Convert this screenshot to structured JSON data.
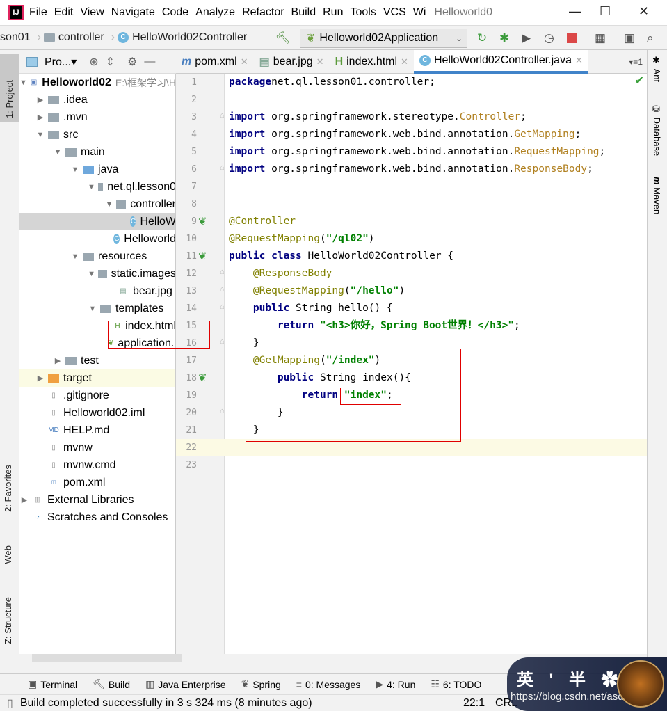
{
  "menubar": {
    "items": [
      "File",
      "Edit",
      "View",
      "Navigate",
      "Code",
      "Analyze",
      "Refactor",
      "Build",
      "Run",
      "Tools",
      "VCS",
      "Wi"
    ],
    "title": "Helloworld0"
  },
  "navbar": {
    "crumbs": [
      "son01",
      "controller",
      "HelloWorld02Controller"
    ],
    "run_config": "Helloworld02Application"
  },
  "project_panel": {
    "title": "Pro..."
  },
  "left_stripe": {
    "tabs": [
      "1: Project",
      "2: Favorites",
      "Web",
      "Z: Structure"
    ]
  },
  "right_stripe": {
    "tabs": [
      "Ant",
      "Database",
      "Maven"
    ]
  },
  "tree": [
    {
      "label": "Helloworld02",
      "sub": "E:\\框架学习\\H",
      "level": 0,
      "arrow": "down",
      "icon": "module",
      "bold": true
    },
    {
      "label": ".idea",
      "level": 1,
      "arrow": "right",
      "icon": "folder"
    },
    {
      "label": ".mvn",
      "level": 1,
      "arrow": "right",
      "icon": "folder"
    },
    {
      "label": "src",
      "level": 1,
      "arrow": "down",
      "icon": "folder"
    },
    {
      "label": "main",
      "level": 2,
      "arrow": "down",
      "icon": "folder"
    },
    {
      "label": "java",
      "level": 3,
      "arrow": "down",
      "icon": "folder-blue"
    },
    {
      "label": "net.ql.lesson0",
      "level": 4,
      "arrow": "down",
      "icon": "package"
    },
    {
      "label": "controller",
      "level": 5,
      "arrow": "down",
      "icon": "package"
    },
    {
      "label": "HelloW",
      "level": 6,
      "arrow": "",
      "icon": "class",
      "selected": true
    },
    {
      "label": "Helloworld",
      "level": 5,
      "arrow": "",
      "icon": "spring-class"
    },
    {
      "label": "resources",
      "level": 3,
      "arrow": "down",
      "icon": "folder-res"
    },
    {
      "label": "static.images",
      "level": 4,
      "arrow": "down",
      "icon": "folder"
    },
    {
      "label": "bear.jpg",
      "level": 5,
      "arrow": "",
      "icon": "image"
    },
    {
      "label": "templates",
      "level": 4,
      "arrow": "down",
      "icon": "folder"
    },
    {
      "label": "index.html",
      "level": 5,
      "arrow": "",
      "icon": "html"
    },
    {
      "label": "application.pr",
      "level": 5,
      "arrow": "",
      "icon": "properties"
    },
    {
      "label": "test",
      "level": 2,
      "arrow": "right",
      "icon": "folder"
    },
    {
      "label": "target",
      "level": 1,
      "arrow": "right",
      "icon": "folder-orange",
      "highlight": true
    },
    {
      "label": ".gitignore",
      "level": 1,
      "arrow": "",
      "icon": "file"
    },
    {
      "label": "Helloworld02.iml",
      "level": 1,
      "arrow": "",
      "icon": "file"
    },
    {
      "label": "HELP.md",
      "level": 1,
      "arrow": "",
      "icon": "md"
    },
    {
      "label": "mvnw",
      "level": 1,
      "arrow": "",
      "icon": "file"
    },
    {
      "label": "mvnw.cmd",
      "level": 1,
      "arrow": "",
      "icon": "file"
    },
    {
      "label": "pom.xml",
      "level": 1,
      "arrow": "",
      "icon": "maven"
    },
    {
      "label": "External Libraries",
      "level": 0,
      "arrow": "right",
      "icon": "libraries"
    },
    {
      "label": "Scratches and Consoles",
      "level": 0,
      "arrow": "",
      "icon": "scratches"
    }
  ],
  "tabs": [
    {
      "label": "pom.xml",
      "icon": "maven"
    },
    {
      "label": "bear.jpg",
      "icon": "image"
    },
    {
      "label": "index.html",
      "icon": "html"
    },
    {
      "label": "HelloWorld02Controller.java",
      "icon": "class",
      "active": true
    }
  ],
  "tabs_overflow": "1",
  "editor": {
    "current_line": 22,
    "lines": [
      [
        [
          "kw",
          "package"
        ],
        [
          "",
          "net.ql.lesson01.controller;"
        ]
      ],
      [],
      [
        [
          "kw",
          "import"
        ],
        [
          "",
          " org.springframework.stereotype."
        ],
        [
          "cn",
          "Controller"
        ],
        [
          "",
          ";"
        ]
      ],
      [
        [
          "kw",
          "import"
        ],
        [
          "",
          " org.springframework.web.bind.annotation."
        ],
        [
          "cn",
          "GetMapping"
        ],
        [
          "",
          ";"
        ]
      ],
      [
        [
          "kw",
          "import"
        ],
        [
          "",
          " org.springframework.web.bind.annotation."
        ],
        [
          "cn",
          "RequestMapping"
        ],
        [
          "",
          ";"
        ]
      ],
      [
        [
          "kw",
          "import"
        ],
        [
          "",
          " org.springframework.web.bind.annotation."
        ],
        [
          "cn",
          "ResponseBody"
        ],
        [
          "",
          ";"
        ]
      ],
      [],
      [],
      [
        [
          "an",
          "@Controller"
        ]
      ],
      [
        [
          "an",
          "@RequestMapping"
        ],
        [
          "",
          "("
        ],
        [
          "st",
          "\"/ql02\""
        ],
        [
          "",
          ")"
        ]
      ],
      [
        [
          "kw",
          "public class"
        ],
        [
          "",
          " HelloWorld02Controller {"
        ]
      ],
      [
        [
          "",
          "    "
        ],
        [
          "an",
          "@ResponseBody"
        ]
      ],
      [
        [
          "",
          "    "
        ],
        [
          "an",
          "@RequestMapping"
        ],
        [
          "",
          "("
        ],
        [
          "st",
          "\"/hello\""
        ],
        [
          "",
          ")"
        ]
      ],
      [
        [
          "",
          "    "
        ],
        [
          "kw",
          "public"
        ],
        [
          "",
          " String hello() {"
        ]
      ],
      [
        [
          "",
          "        "
        ],
        [
          "kw",
          "return"
        ],
        [
          "",
          " "
        ],
        [
          "st",
          "\"<h3>你好，Spring Boot世界！</h3>\""
        ],
        [
          "",
          ";"
        ]
      ],
      [
        [
          "",
          "    }"
        ]
      ],
      [
        [
          "",
          "    "
        ],
        [
          "an",
          "@GetMapping"
        ],
        [
          "",
          "("
        ],
        [
          "st",
          "\"/index\""
        ],
        [
          "",
          ")"
        ]
      ],
      [
        [
          "",
          "        "
        ],
        [
          "kw",
          "public"
        ],
        [
          "",
          " String index(){"
        ]
      ],
      [
        [
          "",
          "            "
        ],
        [
          "kw",
          "return"
        ],
        [
          "",
          " "
        ],
        [
          "st",
          "\"index\""
        ],
        [
          "",
          ";"
        ]
      ],
      [
        [
          "",
          "        }"
        ]
      ],
      [
        [
          "",
          "    }"
        ]
      ],
      [],
      []
    ]
  },
  "bottom_tools": [
    {
      "label": "Terminal",
      "icon": "terminal"
    },
    {
      "label": "Build",
      "icon": "hammer"
    },
    {
      "label": "Java Enterprise",
      "icon": "java-enterprise"
    },
    {
      "label": "Spring",
      "icon": "spring-leaf"
    },
    {
      "label": "0: Messages",
      "icon": "messages"
    },
    {
      "label": "4: Run",
      "icon": "run"
    },
    {
      "label": "6: TODO",
      "icon": "todo"
    }
  ],
  "status": {
    "message": "Build completed successfully in 3 s 324 ms (8 minutes ago)",
    "position": "22:1",
    "line_sep": "CRL"
  },
  "watermark": {
    "text": "英 ' 半 ✿",
    "url": "https://blog.csdn.net/asdhkjdk"
  }
}
